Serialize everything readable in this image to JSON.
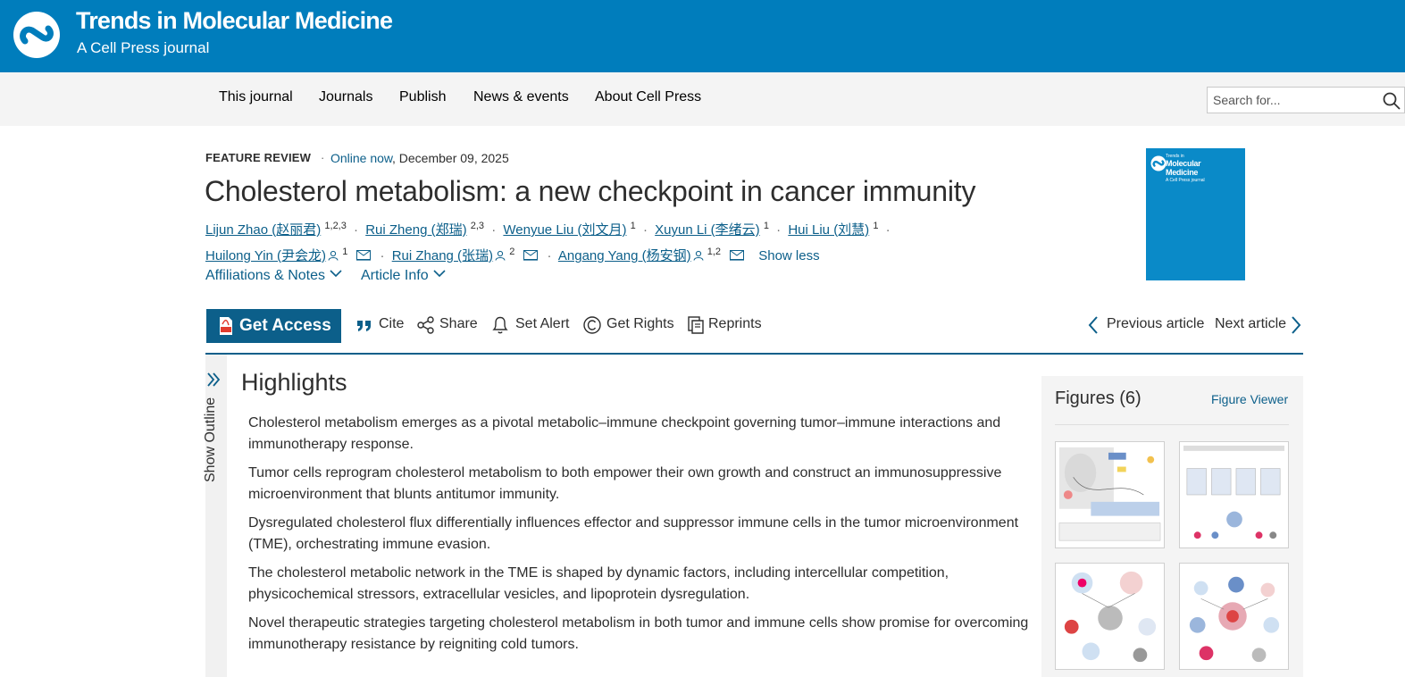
{
  "header": {
    "journal_title": "Trends in Molecular Medicine",
    "journal_subtitle": "A Cell Press journal"
  },
  "nav": {
    "items": [
      "This journal",
      "Journals",
      "Publish",
      "News & events",
      "About Cell Press"
    ],
    "search_placeholder": "Search for..."
  },
  "article": {
    "type": "FEATURE REVIEW",
    "dot": "·",
    "online_label": "Online now",
    "date": ", December 09, 2025",
    "title": "Cholesterol metabolism: a new checkpoint in cancer immunity",
    "authors": [
      {
        "name": "Lijun Zhao (赵丽君)",
        "sup": "1,2,3"
      },
      {
        "name": "Rui Zheng (郑瑞)",
        "sup": "2,3"
      },
      {
        "name": "Wenyue Liu (刘文月)",
        "sup": "1"
      },
      {
        "name": "Xuyun Li (李绪云)",
        "sup": "1"
      },
      {
        "name": "Hui Liu (刘慧)",
        "sup": "1"
      },
      {
        "name": "Huilong Yin (尹会龙)",
        "sup": "1"
      },
      {
        "name": "Rui Zhang (张瑞)",
        "sup": "2"
      },
      {
        "name": "Angang Yang (杨安钢)",
        "sup": "1,2"
      }
    ],
    "show_less": "Show less",
    "affiliations_label": "Affiliations & Notes",
    "article_info_label": "Article Info"
  },
  "cover": {
    "line1": "Trends in",
    "line2a": "Molecular",
    "line2b": "Medicine",
    "line3": "A Cell Press journal"
  },
  "toolbar": {
    "get_access": "Get Access",
    "cite": "Cite",
    "share": "Share",
    "set_alert": "Set Alert",
    "get_rights": "Get Rights",
    "reprints": "Reprints",
    "previous": "Previous article",
    "next": "Next article"
  },
  "outline": {
    "label": "Show Outline"
  },
  "highlights": {
    "heading": "Highlights",
    "items": [
      "Cholesterol metabolism emerges as a pivotal metabolic–immune checkpoint governing tumor–immune interactions and immunotherapy response.",
      "Tumor cells reprogram cholesterol metabolism to both empower their own growth and construct an immunosuppressive microenvironment that blunts antitumor immunity.",
      "Dysregulated cholesterol flux differentially influences effector and suppressor immune cells in the tumor microenvironment (TME), orchestrating immune evasion.",
      "The cholesterol metabolic network in the TME is shaped by dynamic factors, including intercellular competition, physicochemical stressors, extracellular vesicles, and lipoprotein dysregulation.",
      "Novel therapeutic strategies targeting cholesterol metabolism in both tumor and immune cells show promise for overcoming immunotherapy resistance by reigniting cold tumors."
    ]
  },
  "figures": {
    "title": "Figures (6)",
    "viewer_label": "Figure Viewer"
  },
  "colors": {
    "header_blue": "#007dbc",
    "link_blue": "#0c5f8a",
    "nav_bg": "#f4f4f4"
  }
}
